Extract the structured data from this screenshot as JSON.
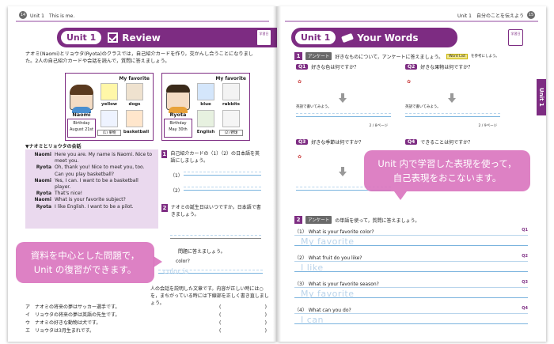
{
  "left": {
    "page_number": "14",
    "running_head": "Unit 1　This is me.",
    "unit": "Unit 1",
    "banner_title": "Review",
    "stamp": "学習日",
    "intro": "ナオミ(Naomi)とリョウタ(Ryota)のクラスでは，自己紹介カードを作り，交かんし合うことになりました。2人の自己紹介カードや会話を読んで，質問に答えましょう。",
    "cards": [
      {
        "fav": "My favorite",
        "name": "Naomi",
        "birthday_label": "Birthday",
        "birthday": "August 21st",
        "items": [
          "yellow",
          "dogs",
          "basketball"
        ],
        "blank": "(1) 果物"
      },
      {
        "fav": "My favorite",
        "name": "Ryota",
        "birthday_label": "Birthday",
        "birthday": "May 30th",
        "items": [
          "blue",
          "rabbits",
          "English"
        ],
        "blank": "(2) 野球"
      }
    ],
    "dialogue_title": "▼ナオミとリョウタの会話",
    "dialogue": [
      {
        "speaker": "Naomi",
        "text": "Here you are. My name is Naomi. Nice to meet you."
      },
      {
        "speaker": "Ryota",
        "text": "Oh, thank you! Nice to meet you, too. Can you play basketball?"
      },
      {
        "speaker": "Naomi",
        "text": "Yes, I can. I want to be a basketball player."
      },
      {
        "speaker": "Ryota",
        "text": "That's nice!"
      },
      {
        "speaker": "Naomi",
        "text": "What is your favorite subject?"
      },
      {
        "speaker": "Ryota",
        "text": "I like English. I want to be a pilot."
      }
    ],
    "q1": "自己紹介カードの（1）（2）の日本語を英語にしましょう。",
    "q1_blanks": [
      "（1）",
      "（2）"
    ],
    "q2": "ナオミの誕生日はいつですか。日本語で書きましょう。",
    "q3_fragment_a": "問題に答えましょう。",
    "q3_fragment_b": "color?",
    "q3_fragment_c": "color is",
    "q4_fragment": "人の会話を説明した文章です。内容が正しい時には○を，まちがっている時には下線部を正しく書き直しましょう。",
    "statements": [
      {
        "k": "ア",
        "text": "ナオミの将来の夢はサッカー選手です。"
      },
      {
        "k": "イ",
        "text": "リョウタの将来の夢は英語の先生です。"
      },
      {
        "k": "ウ",
        "text": "ナオミの好きな動物は犬です。"
      },
      {
        "k": "エ",
        "text": "リョウタは3月生まれです。"
      }
    ],
    "paren_open": "(",
    "paren_close": ")",
    "callout": "資料を中心とした問題で，\nUnit の復習ができます。"
  },
  "right": {
    "page_number": "15",
    "running_head": "Unit 1　自分のことを伝えよう",
    "unit": "Unit 1",
    "banner_title": "Your Words",
    "stamp": "学習日",
    "side_tab": "Unit 1",
    "s1_chip": "アンケート",
    "s1_text": "好きなものについて，アンケートに答えましょう。",
    "s1_wordlist": "Word List",
    "s1_note": "を参考にしよう。",
    "questions": [
      {
        "tag": "Q1",
        "text": "好きな色は何ですか？",
        "note": "2 / 8ページ"
      },
      {
        "tag": "Q2",
        "text": "好きな果物は何ですか？",
        "note": "2 / 9ページ"
      },
      {
        "tag": "Q3",
        "text": "好きな季節は何ですか？",
        "note": ""
      },
      {
        "tag": "Q4",
        "text": "できることは何ですか？",
        "note": ""
      }
    ],
    "english_prompt": "英語で書いてみよう。",
    "s2_chip": "アンケート",
    "s2_text": "の単語を使って，質問に答えましょう。",
    "answers": [
      {
        "q": "（1） What is your favorite color?",
        "ref": "Q1",
        "trace": "My favorite"
      },
      {
        "q": "（2） What fruit do you like?",
        "ref": "Q2",
        "trace": "I like"
      },
      {
        "q": "（3） What is your favorite season?",
        "ref": "Q3",
        "trace": "My favorite"
      },
      {
        "q": "（4） What can you do?",
        "ref": "Q4",
        "trace": "I can"
      }
    ],
    "callout": "Unit 内で学習した表現を使って，\n自己表現をおこないます。"
  },
  "colors": {
    "accent": "#7d2c82",
    "callout": "#d870bc"
  }
}
